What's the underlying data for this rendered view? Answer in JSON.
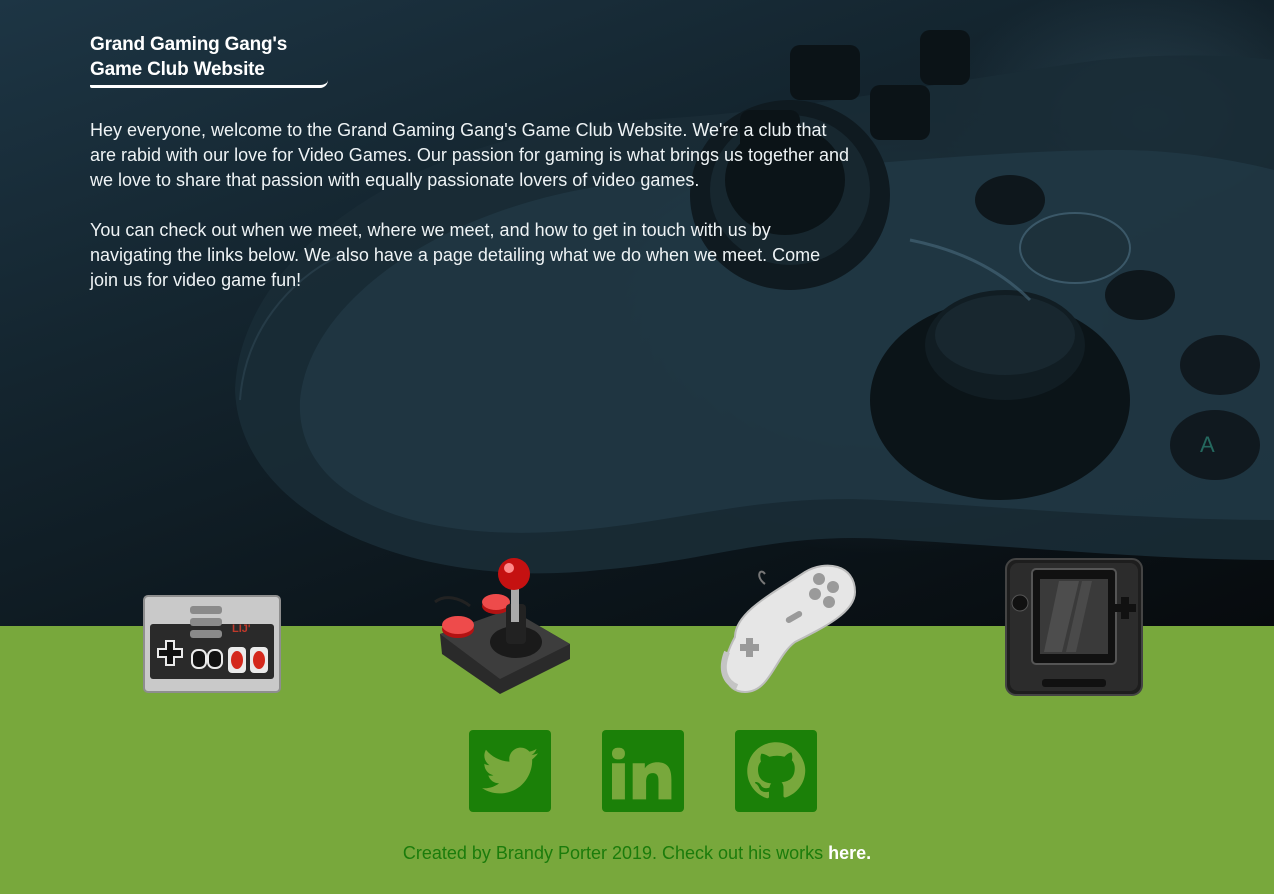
{
  "header": {
    "title": "Grand Gaming Gang's Game Club Website"
  },
  "intro": {
    "paragraph_1": "Hey everyone, welcome to the Grand Gaming Gang's Game Club Website. We're a club that are rabid with our love for Video Games. Our passion for gaming is what brings us together and we love to share that passion with equally passionate lovers of video games.",
    "paragraph_2": "You can check out when we meet, where we meet, and how to get in touch with us by navigating the links below. We also have a page detailing what we do when we meet. Come join us for video game fun!"
  },
  "nav_links": [
    {
      "icon": "nes-controller-icon"
    },
    {
      "icon": "arcade-joystick-icon"
    },
    {
      "icon": "gamepad-icon"
    },
    {
      "icon": "handheld-console-icon"
    }
  ],
  "social": [
    {
      "icon": "twitter-icon"
    },
    {
      "icon": "linkedin-icon"
    },
    {
      "icon": "github-icon"
    }
  ],
  "footer": {
    "text": "Created by Brandy Porter 2019. Check out his works ",
    "link_label": "here."
  },
  "colors": {
    "page_green": "#78a83c",
    "social_green": "#1b8008",
    "footer_text": "#1b7c0b",
    "hero_dark": "#0c161c"
  }
}
